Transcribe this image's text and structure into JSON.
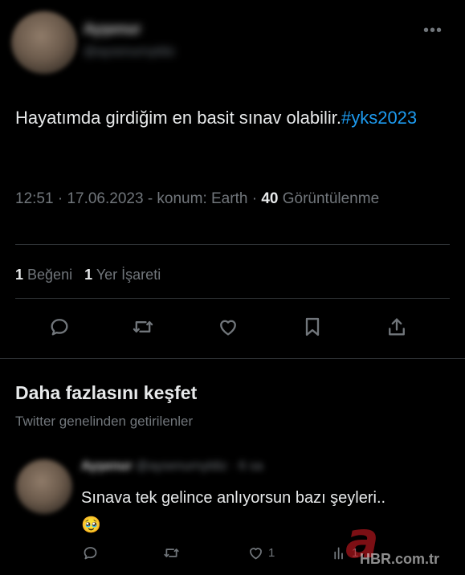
{
  "tweet": {
    "author_name": "Ayşenur",
    "author_handle": "@aysenurnyldiz",
    "more_icon": "more-horizontal-icon",
    "text_main": "Hayatımda girdiğim en basit sınav olabilir.",
    "hashtag": "#yks2023",
    "time": "12:51",
    "date": "17.06.2023",
    "location": "konum: Earth",
    "views_count": "40",
    "views_label": "Görüntülenme",
    "likes_count": "1",
    "likes_label": "Beğeni",
    "bookmarks_count": "1",
    "bookmarks_label": "Yer İşareti"
  },
  "actions": [
    {
      "icon": "reply-icon"
    },
    {
      "icon": "retweet-icon"
    },
    {
      "icon": "like-icon"
    },
    {
      "icon": "bookmark-icon"
    },
    {
      "icon": "share-icon"
    }
  ],
  "discover": {
    "title": "Daha fazlasını keşfet",
    "subtitle": "Twitter genelinden getirilenler"
  },
  "reply": {
    "author_name": "Ayşenur",
    "author_handle": "@aysenurnyldiz",
    "time": "6 sa",
    "text": "Sınava tek gelince anlıyorsun bazı şeyleri..🥹",
    "like_count": "1",
    "views_count": "1"
  },
  "watermark": {
    "letter": "a",
    "text": "HBR.com.tr"
  },
  "colors": {
    "background": "#000000",
    "text": "#e7e9ea",
    "muted": "#71767b",
    "link": "#1d9bf0",
    "divider": "#2f3336"
  }
}
